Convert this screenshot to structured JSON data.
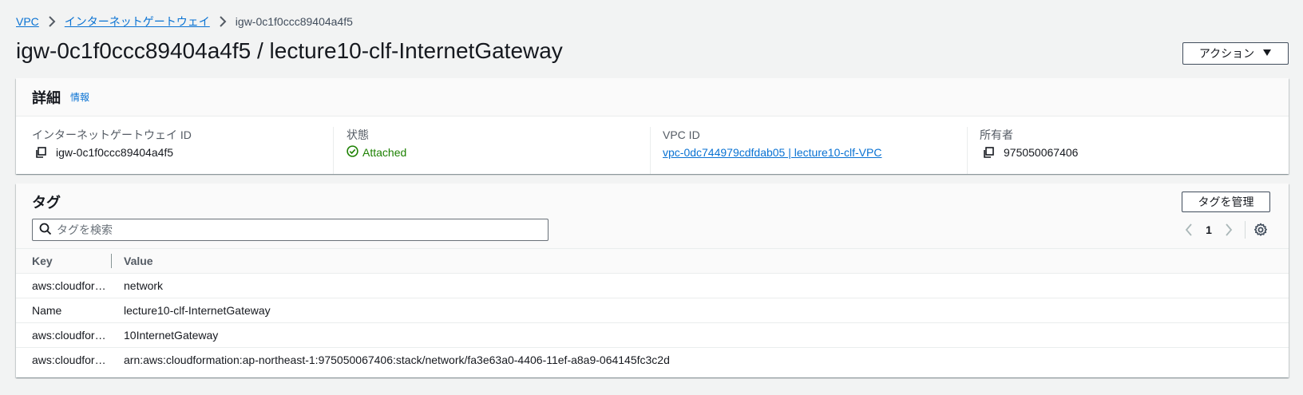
{
  "breadcrumb": {
    "items": [
      "VPC",
      "インターネットゲートウェイ"
    ],
    "current": "igw-0c1f0ccc89404a4f5"
  },
  "header": {
    "title": "igw-0c1f0ccc89404a4f5 / lecture10-clf-InternetGateway",
    "actions_label": "アクション"
  },
  "details": {
    "title": "詳細",
    "info_label": "情報",
    "fields": [
      {
        "label": "インターネットゲートウェイ ID",
        "value": "igw-0c1f0ccc89404a4f5"
      },
      {
        "label": "状態",
        "value": "Attached"
      },
      {
        "label": "VPC ID",
        "value": "vpc-0dc744979cdfdab05 | lecture10-clf-VPC"
      },
      {
        "label": "所有者",
        "value": "975050067406"
      }
    ]
  },
  "tags": {
    "title": "タグ",
    "manage_label": "タグを管理",
    "search_placeholder": "タグを検索",
    "page": "1",
    "columns": [
      "Key",
      "Value"
    ],
    "rows": [
      {
        "key": "aws:cloudformation:logical-id",
        "value": "network"
      },
      {
        "key": "Name",
        "value": "lecture10-clf-InternetGateway"
      },
      {
        "key": "aws:cloudformation:stack-name",
        "value": "10InternetGateway"
      },
      {
        "key": "aws:cloudformation:stack-id",
        "value": "arn:aws:cloudformation:ap-northeast-1:975050067406:stack/network/fa3e63a0-4406-11ef-a8a9-064145fc3c2d"
      }
    ]
  },
  "colors": {
    "link": "#0972d3",
    "success": "#1d8102",
    "background": "#f2f3f3"
  }
}
